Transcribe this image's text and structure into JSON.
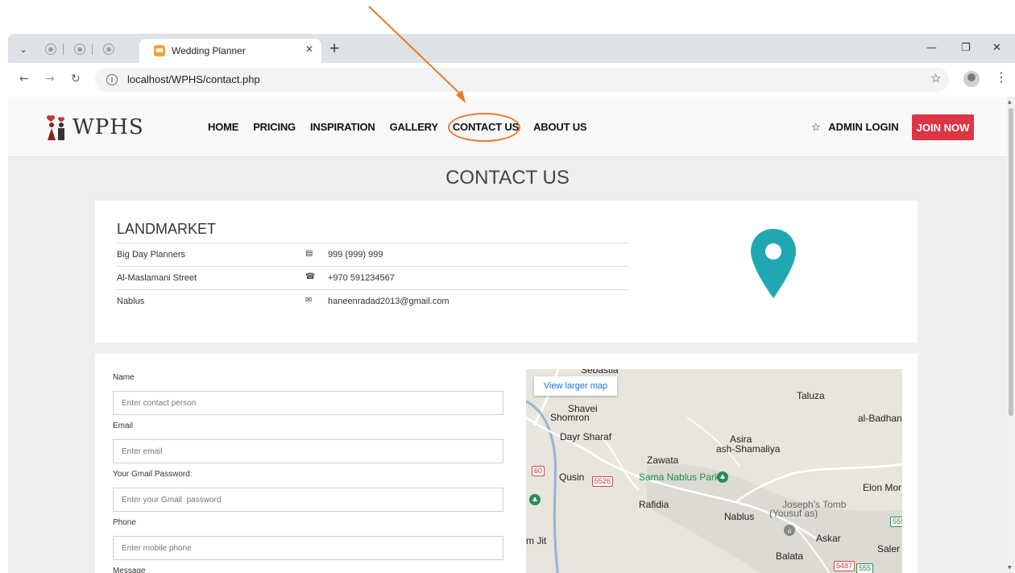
{
  "browser": {
    "tab_title": "Wedding Planner",
    "url": "localhost/WPHS/contact.php"
  },
  "site": {
    "logo_text": "WPHS",
    "nav": [
      "HOME",
      "PRICING",
      "INSPIRATION",
      "GALLERY",
      "CONTACT US",
      "ABOUT US"
    ],
    "admin_login": "ADMIN LOGIN",
    "join_now": "JOIN NOW"
  },
  "page": {
    "title": "CONTACT US"
  },
  "company": {
    "name": "LANDMARKET",
    "rows": [
      {
        "left": "Big Day Planners",
        "icon": "fax-icon",
        "value": "999 (999) 999"
      },
      {
        "left": "Al-Maslamani Street",
        "icon": "phone-icon",
        "value": "+970 591234567"
      },
      {
        "left": "Nablus",
        "icon": "envelope-icon",
        "value": "haneenradad2013@gmail.com"
      }
    ]
  },
  "form": {
    "name_label": "Name",
    "name_placeholder": "Enter contact person",
    "email_label": "Email",
    "email_placeholder": "Enter email",
    "gmail_pw_label": "Your Gmail Password:",
    "gmail_pw_placeholder": "Enter your Gmail  password",
    "phone_label": "Phone",
    "phone_placeholder": "Enter mobile phone",
    "message_label": "Message"
  },
  "map": {
    "view_larger": "View larger map",
    "labels": {
      "sebastia": "Sebastia",
      "taluza": "Taluza",
      "shavei": "Shavei",
      "shomron": "Shomron",
      "al_badhan": "al-Badhan",
      "dayr_sharaf": "Dayr Sharaf",
      "asira": "Asira",
      "ash_shamaliya": "ash-Shamaliya",
      "zawata": "Zawata",
      "qusin": "Qusin",
      "sama_park": "Sama Nablus Park",
      "elon_moreh": "Elon Mor",
      "rafidia": "Rafidia",
      "josephs_tomb": "Joseph's Tomb",
      "yousuf_as": "(Yousuf as)",
      "nablus": "Nablus",
      "askar": "Askar",
      "jit": "m Jit",
      "balata": "Balata",
      "saler": "Saler"
    },
    "shields": {
      "r60": "60",
      "r5526": "5526",
      "r5487": "5487",
      "r555a": "555",
      "r555b": "555"
    }
  },
  "colors": {
    "annotation": "#e47b2d",
    "join_button": "#dc3545",
    "pin": "#1fa8b2"
  }
}
